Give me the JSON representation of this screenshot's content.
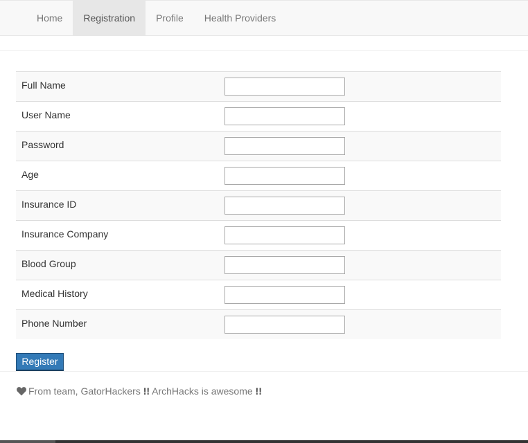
{
  "nav": {
    "items": [
      {
        "label": "Home",
        "active": false
      },
      {
        "label": "Registration",
        "active": true
      },
      {
        "label": "Profile",
        "active": false
      },
      {
        "label": "Health Providers",
        "active": false
      }
    ]
  },
  "form": {
    "fields": [
      {
        "label": "Full Name",
        "value": ""
      },
      {
        "label": "User Name",
        "value": ""
      },
      {
        "label": "Password",
        "value": ""
      },
      {
        "label": "Age",
        "value": ""
      },
      {
        "label": "Insurance ID",
        "value": ""
      },
      {
        "label": "Insurance Company",
        "value": ""
      },
      {
        "label": "Blood Group",
        "value": ""
      },
      {
        "label": "Medical History",
        "value": ""
      },
      {
        "label": "Phone Number",
        "value": ""
      }
    ],
    "submit_label": "Register"
  },
  "footer": {
    "icon": "heart-icon",
    "text_part1": "From team, GatorHackers ",
    "mark1": "!!",
    "text_part2": " ArchHacks is awesome ",
    "mark2": "!!"
  },
  "colors": {
    "primary": "#337ab7",
    "nav_bg": "#f8f8f8",
    "nav_active_bg": "#e7e7e7",
    "row_stripe": "#f9f9f9"
  }
}
